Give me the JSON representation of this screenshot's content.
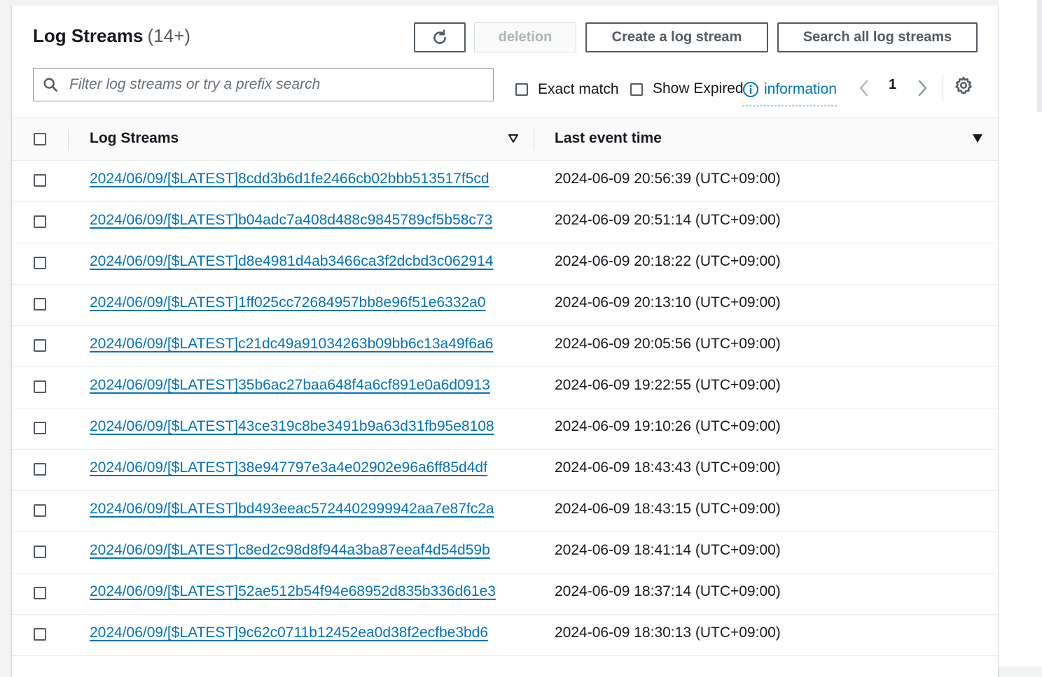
{
  "header": {
    "title": "Log Streams",
    "count": "(14+)"
  },
  "toolbar": {
    "refresh_icon": "refresh-icon",
    "deletion_label": "deletion",
    "create_label": "Create a log stream",
    "search_all_label": "Search all log streams"
  },
  "filter": {
    "placeholder": "Filter log streams or try a prefix search",
    "value": ""
  },
  "options": {
    "exact_match_label": "Exact match",
    "show_expired_label": "Show Expired",
    "info_label": "information"
  },
  "pagination": {
    "current_page": "1"
  },
  "table": {
    "columns": [
      "Log Streams",
      "Last event time"
    ],
    "rows": [
      {
        "stream": "2024/06/09/[$LATEST]8cdd3b6d1fe2466cb02bbb513517f5cd",
        "time": "2024-06-09 20:56:39 (UTC+09:00)"
      },
      {
        "stream": "2024/06/09/[$LATEST]b04adc7a408d488c9845789cf5b58c73",
        "time": "2024-06-09 20:51:14 (UTC+09:00)"
      },
      {
        "stream": "2024/06/09/[$LATEST]d8e4981d4ab3466ca3f2dcbd3c062914",
        "time": "2024-06-09 20:18:22 (UTC+09:00)"
      },
      {
        "stream": "2024/06/09/[$LATEST]1ff025cc72684957bb8e96f51e6332a0",
        "time": "2024-06-09 20:13:10 (UTC+09:00)"
      },
      {
        "stream": "2024/06/09/[$LATEST]c21dc49a91034263b09bb6c13a49f6a6",
        "time": "2024-06-09 20:05:56 (UTC+09:00)"
      },
      {
        "stream": "2024/06/09/[$LATEST]35b6ac27baa648f4a6cf891e0a6d0913",
        "time": "2024-06-09 19:22:55 (UTC+09:00)"
      },
      {
        "stream": "2024/06/09/[$LATEST]43ce319c8be3491b9a63d31fb95e8108",
        "time": "2024-06-09 19:10:26 (UTC+09:00)"
      },
      {
        "stream": "2024/06/09/[$LATEST]38e947797e3a4e02902e96a6ff85d4df",
        "time": "2024-06-09 18:43:43 (UTC+09:00)"
      },
      {
        "stream": "2024/06/09/[$LATEST]bd493eeac5724402999942aa7e87fc2a",
        "time": "2024-06-09 18:43:15 (UTC+09:00)"
      },
      {
        "stream": "2024/06/09/[$LATEST]c8ed2c98d8f944a3ba87eeaf4d54d59b",
        "time": "2024-06-09 18:41:14 (UTC+09:00)"
      },
      {
        "stream": "2024/06/09/[$LATEST]52ae512b54f94e68952d835b336d61e3",
        "time": "2024-06-09 18:37:14 (UTC+09:00)"
      },
      {
        "stream": "2024/06/09/[$LATEST]9c62c0711b12452ea0d38f2ecfbe3bd6",
        "time": "2024-06-09 18:30:13 (UTC+09:00)"
      }
    ]
  },
  "colors": {
    "link": "#0073bb",
    "text": "#16191f",
    "border": "#eaeded"
  }
}
